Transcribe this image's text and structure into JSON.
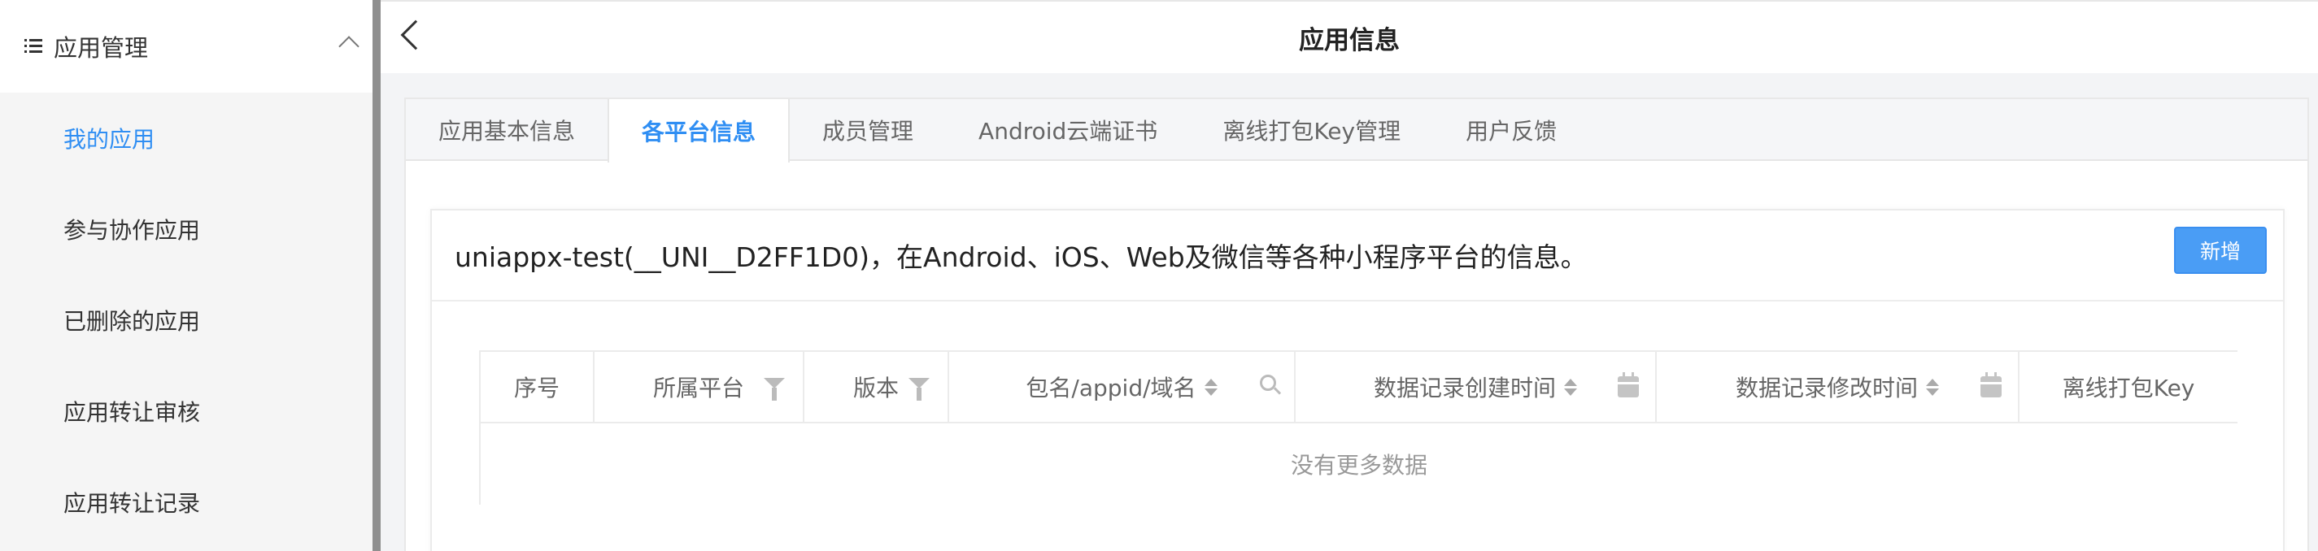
{
  "sidebar": {
    "title": "应用管理",
    "icon": "list-icon",
    "items": [
      {
        "label": "我的应用",
        "active": true
      },
      {
        "label": "参与协作应用"
      },
      {
        "label": "已删除的应用"
      },
      {
        "label": "应用转让审核"
      },
      {
        "label": "应用转让记录"
      }
    ]
  },
  "header": {
    "title": "应用信息",
    "back_icon": "chevron-left-icon"
  },
  "tabs": [
    {
      "label": "应用基本信息"
    },
    {
      "label": "各平台信息",
      "active": true
    },
    {
      "label": "成员管理"
    },
    {
      "label": "Android云端证书"
    },
    {
      "label": "离线打包Key管理"
    },
    {
      "label": "用户反馈"
    }
  ],
  "card": {
    "title": "uniappx-test(__UNI__D2FF1D0)，在Android、iOS、Web及微信等各种小程序平台的信息。",
    "add_button": "新增"
  },
  "table": {
    "columns": [
      {
        "label": "序号"
      },
      {
        "label": "所属平台",
        "filter": true
      },
      {
        "label": "版本",
        "filter": true
      },
      {
        "label": "包名/appid/域名",
        "sortable": true,
        "search": true
      },
      {
        "label": "数据记录创建时间",
        "sortable": true,
        "date": true
      },
      {
        "label": "数据记录修改时间",
        "sortable": true,
        "date": true
      },
      {
        "label": "离线打包Key"
      }
    ],
    "empty_text": "没有更多数据"
  },
  "colors": {
    "accent": "#2f8ef3",
    "button": "#4a9df5"
  }
}
